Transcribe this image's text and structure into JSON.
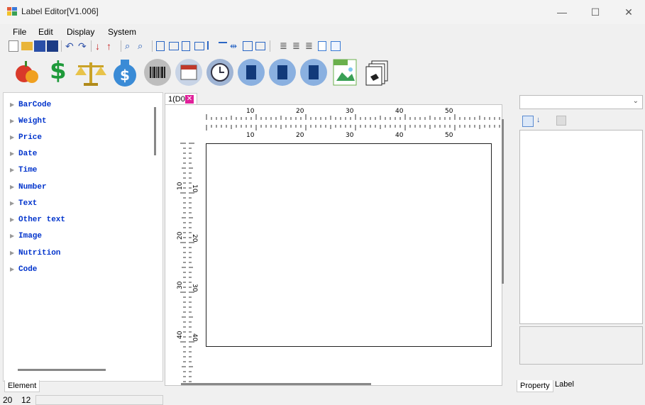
{
  "window": {
    "title": "Label Editor[V1.006]",
    "minimize": "—",
    "maximize": "☐",
    "close": "✕"
  },
  "menu": [
    "File",
    "Edit",
    "Display",
    "System"
  ],
  "elements_tree": [
    "BarCode",
    "Weight",
    "Price",
    "Date",
    "Time",
    "Number",
    "Text",
    "Other text",
    "Image",
    "Nutrition",
    "Code"
  ],
  "left_tab": "Element",
  "doc_tab": {
    "label": "1(D0"
  },
  "ruler": {
    "h_top": [
      "10",
      "20",
      "30",
      "40",
      "50"
    ],
    "h_bottom": [
      "10",
      "20",
      "30",
      "40",
      "50"
    ],
    "v_left": [
      "10",
      "20",
      "30",
      "40"
    ],
    "v_right": [
      "10",
      "20",
      "30",
      "40"
    ]
  },
  "right_tabs": [
    "Property",
    "Label"
  ],
  "status": {
    "x": "20",
    "y": "12"
  }
}
